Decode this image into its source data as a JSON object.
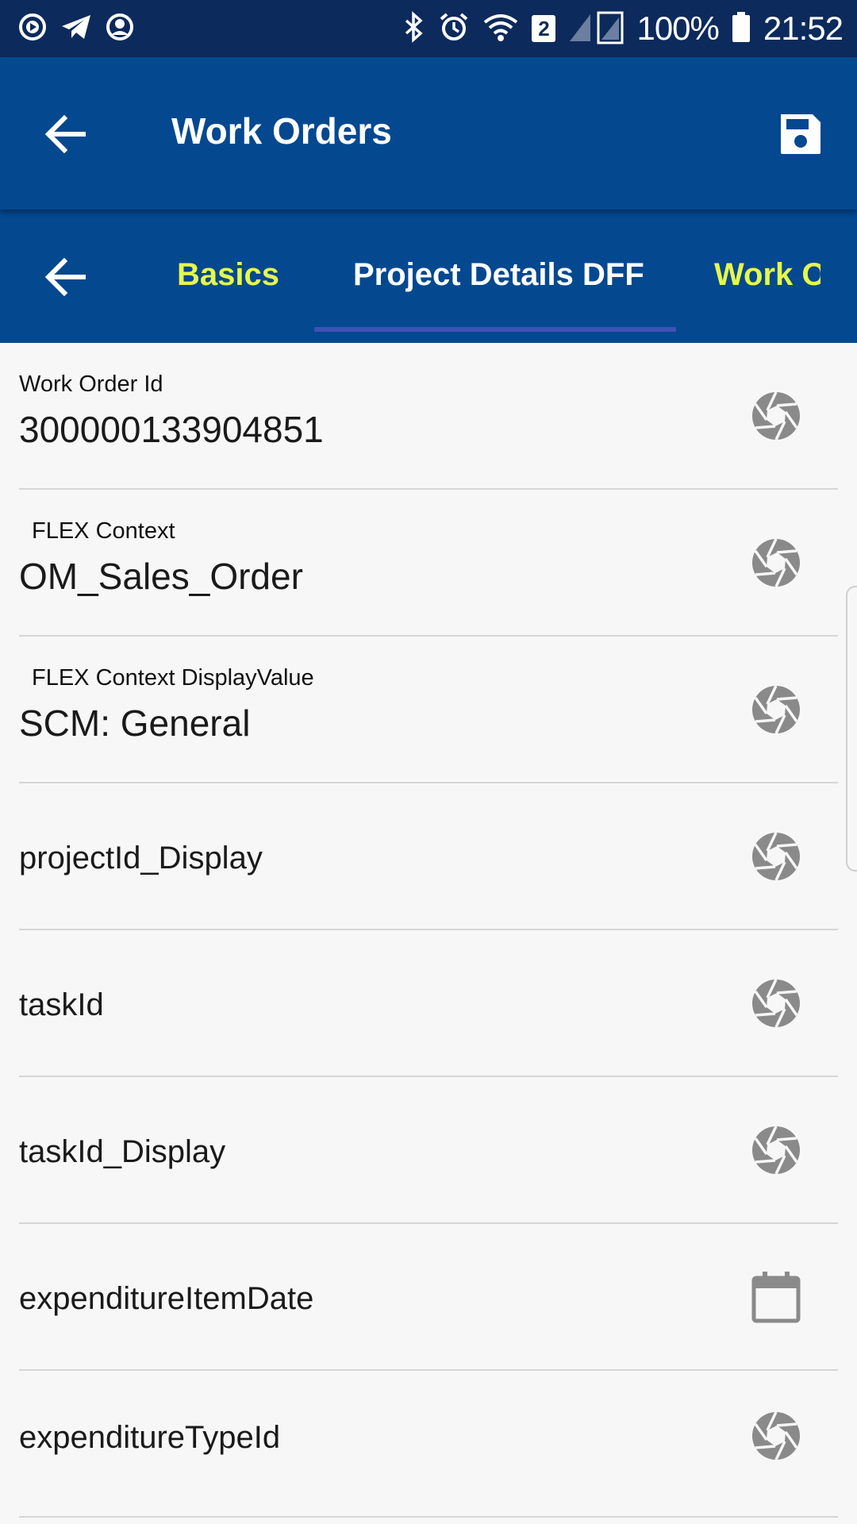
{
  "status_bar": {
    "battery": "100%",
    "time": "21:52",
    "sim_badge": "2",
    "icons": [
      "play-circle-icon",
      "telegram-icon",
      "account-circle-icon",
      "bluetooth-icon",
      "alarm-icon",
      "wifi-icon",
      "signal-icon",
      "battery-icon"
    ]
  },
  "app_bar": {
    "title": "Work Orders",
    "back_icon": "arrow-back-icon",
    "save_icon": "save-icon"
  },
  "tabs": {
    "back_icon": "arrow-back-icon",
    "items": [
      {
        "label": "Basics",
        "active": false
      },
      {
        "label": "Project Details DFF",
        "active": true
      },
      {
        "label": "Work O",
        "active": false
      }
    ],
    "colors": {
      "active": "#ffffff",
      "inactive": "#e6f74c",
      "indicator": "#3f51b5"
    }
  },
  "fields": [
    {
      "label": "Work Order Id",
      "value": "300000133904851",
      "icon": "aperture-icon"
    },
    {
      "label": "FLEX Context",
      "value": "OM_Sales_Order",
      "icon": "aperture-icon"
    },
    {
      "label": "FLEX Context DisplayValue",
      "value": "SCM: General",
      "icon": "aperture-icon"
    },
    {
      "placeholder": "projectId_Display",
      "icon": "aperture-icon"
    },
    {
      "placeholder": "taskId",
      "icon": "aperture-icon"
    },
    {
      "placeholder": "taskId_Display",
      "icon": "aperture-icon"
    },
    {
      "placeholder": "expenditureItemDate",
      "icon": "calendar-icon"
    },
    {
      "placeholder": "expenditureTypeId",
      "icon": "aperture-icon"
    }
  ],
  "colors": {
    "status_bar": "#0c2a5b",
    "app_bar": "#044890",
    "background": "#f7f7f7",
    "icon_gray": "#8a8a8a"
  }
}
